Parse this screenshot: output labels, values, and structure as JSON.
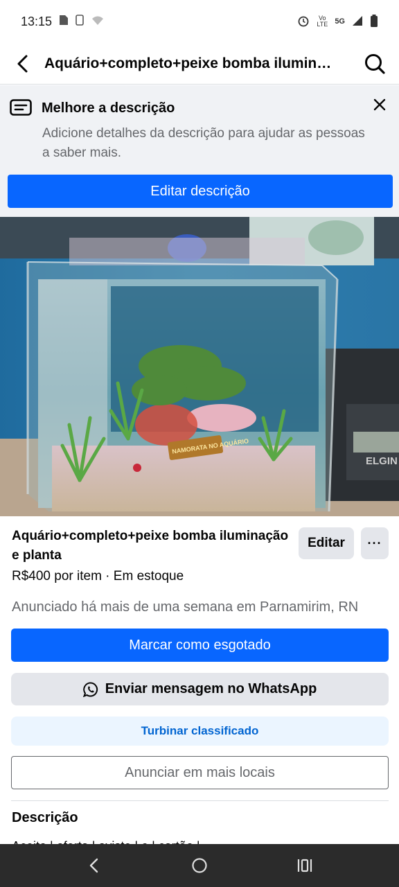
{
  "status": {
    "time": "13:15",
    "network": "5G",
    "volte": "Vo LTE"
  },
  "header": {
    "title": "Aquário+completo+peixe bomba ilumina..."
  },
  "banner": {
    "title": "Melhore a descrição",
    "text": "Adicione detalhes da descrição para ajudar as pessoas a saber mais.",
    "button": "Editar descrição"
  },
  "photo": {
    "sign_text": "NAMORATA NO AQUÁRIO",
    "scale_brand": "ELGIN"
  },
  "listing": {
    "title": "Aquário+completo+peixe bomba iluminação e planta",
    "edit_label": "Editar",
    "more_label": "···",
    "price_line": "R$400 por item · Em estoque",
    "posted_line": "Anunciado há mais de uma semana em Parnamirim, RN",
    "mark_sold": "Marcar como esgotado",
    "whatsapp": "Enviar mensagem no WhatsApp",
    "boost": "Turbinar classificado",
    "more_places": "Anunciar em mais locais",
    "description_heading": "Descrição",
    "description_peek": "Aceito | oferta | aviste | e | cartão |"
  },
  "colors": {
    "primary": "#0866ff",
    "secondary_bg": "#e4e6eb",
    "boost_bg": "#ebf5ff",
    "boost_text": "#0064d1",
    "muted_text": "#65676b"
  }
}
